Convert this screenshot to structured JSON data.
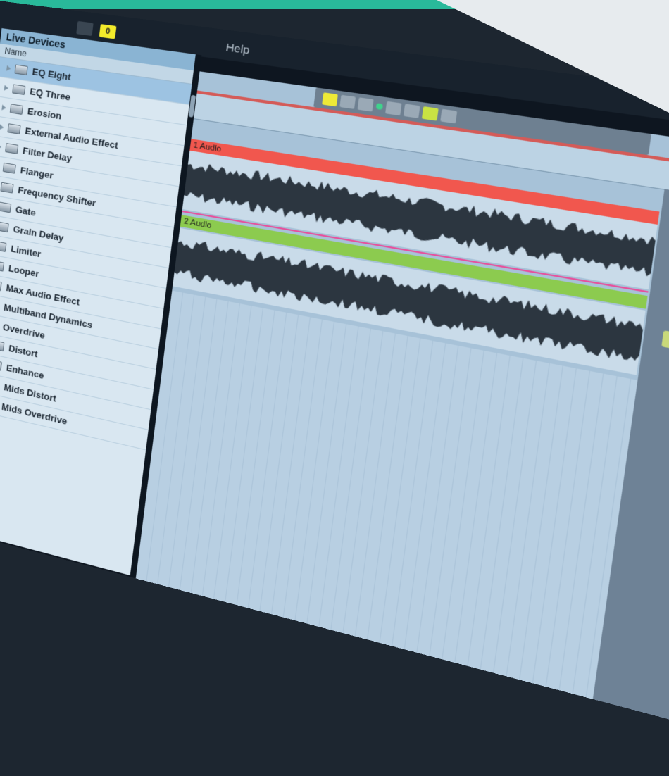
{
  "menubar": {
    "badge": "0",
    "help_label": "Help"
  },
  "browser": {
    "title": "Live Devices",
    "column_header": "Name",
    "items": [
      {
        "label": "EQ Eight",
        "selected": true,
        "open": false
      },
      {
        "label": "EQ Three",
        "open": false
      },
      {
        "label": "Erosion",
        "open": false
      },
      {
        "label": "External Audio Effect",
        "open": false
      },
      {
        "label": "Filter Delay",
        "open": false
      },
      {
        "label": "Flanger",
        "open": false
      },
      {
        "label": "Frequency Shifter",
        "open": false
      },
      {
        "label": "Gate",
        "open": false
      },
      {
        "label": "Grain Delay",
        "open": false
      },
      {
        "label": "Limiter",
        "open": false
      },
      {
        "label": "Looper",
        "open": false
      },
      {
        "label": "Max Audio Effect",
        "open": false
      },
      {
        "label": "Multiband Dynamics",
        "open": false
      },
      {
        "label": "Overdrive",
        "open": true
      },
      {
        "label": "Distort",
        "child": true
      },
      {
        "label": "Enhance",
        "child": true
      },
      {
        "label": "Mids Distort",
        "child": true
      },
      {
        "label": "Mids Overdrive",
        "child": true
      }
    ]
  },
  "tracks": [
    {
      "name": "1 Audio",
      "color": "#f1574e"
    },
    {
      "name": "2 Audio",
      "color": "#8ccb4f"
    }
  ],
  "colors": {
    "accent_top": "#29b99a",
    "accent_left": "#e0523a"
  }
}
